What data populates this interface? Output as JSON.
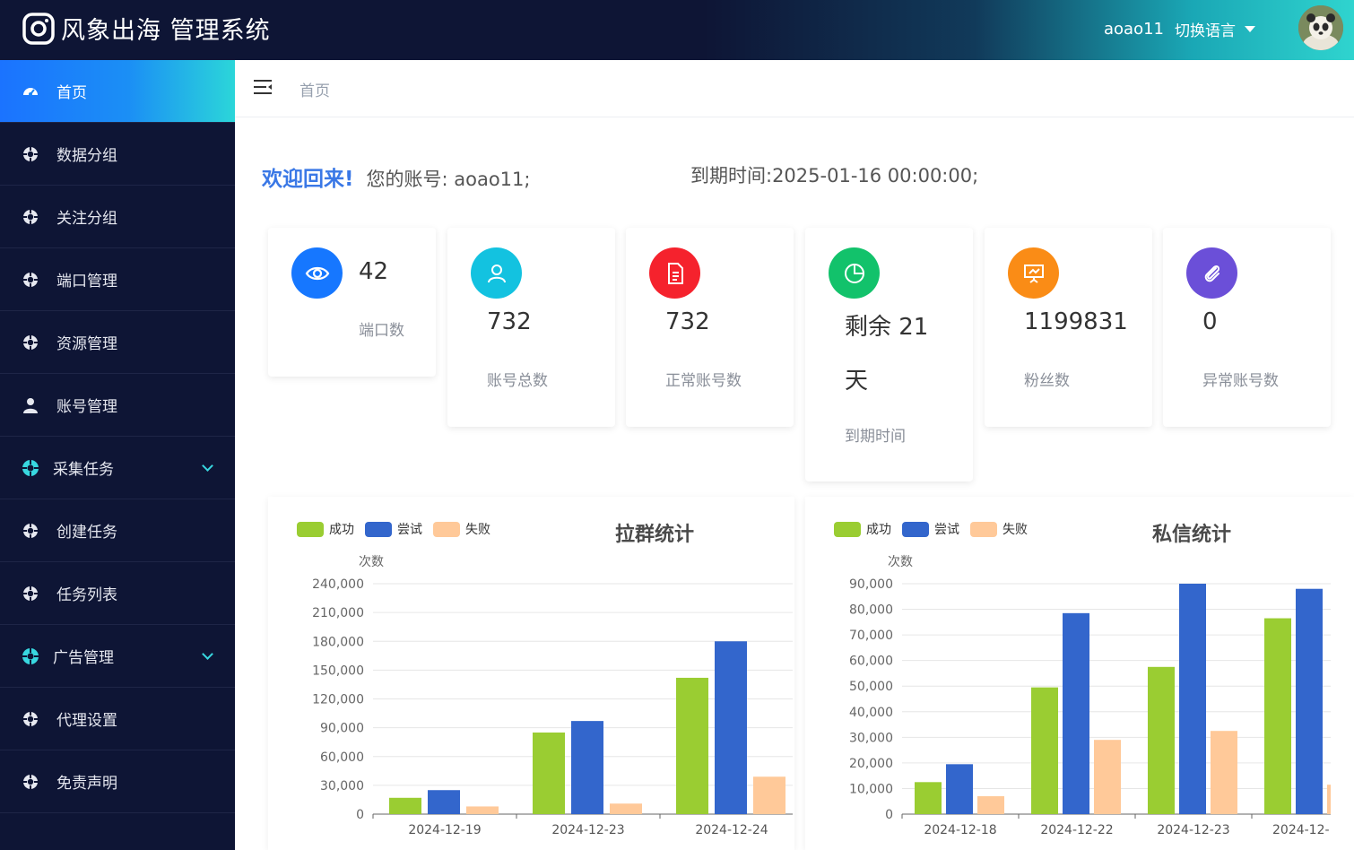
{
  "header": {
    "app_title": "风象出海 管理系统",
    "user_name": "aoao11",
    "lang_switch_label": "切换语言"
  },
  "sidebar": {
    "items": [
      {
        "label": "首页",
        "icon": "dashboard-icon",
        "active": true
      },
      {
        "label": "数据分组",
        "icon": "crosshair-icon"
      },
      {
        "label": "关注分组",
        "icon": "crosshair-icon"
      },
      {
        "label": "端口管理",
        "icon": "crosshair-icon"
      },
      {
        "label": "资源管理",
        "icon": "crosshair-icon"
      },
      {
        "label": "账号管理",
        "icon": "user-icon"
      },
      {
        "label": "采集任务",
        "icon": "crosshair-icon",
        "group": true
      },
      {
        "label": "创建任务",
        "icon": "crosshair-icon"
      },
      {
        "label": "任务列表",
        "icon": "crosshair-icon"
      },
      {
        "label": "广告管理",
        "icon": "crosshair-icon",
        "group": true
      },
      {
        "label": "代理设置",
        "icon": "crosshair-icon"
      },
      {
        "label": "免责声明",
        "icon": "crosshair-icon"
      }
    ]
  },
  "breadcrumb": "首页",
  "welcome": {
    "title": "欢迎回来!",
    "account": "您的账号: aoao11;",
    "expire": "到期时间:2025-01-16 00:00:00;"
  },
  "stats": [
    {
      "value": "42",
      "label": "端口数",
      "icon": "eye-icon",
      "color": "#1677ff"
    },
    {
      "value": "732",
      "label": "账号总数",
      "icon": "user-outline-icon",
      "color": "#13c2e0"
    },
    {
      "value": "732",
      "label": "正常账号数",
      "icon": "document-icon",
      "color": "#f5222d"
    },
    {
      "value_line1": "剩余 21",
      "value_line2": "天",
      "label": "到期时间",
      "icon": "pie-chart-icon",
      "color": "#12c26b"
    },
    {
      "value": "1199831",
      "label": "粉丝数",
      "icon": "presentation-icon",
      "color": "#fa8c16"
    },
    {
      "value": "0",
      "label": "异常账号数",
      "icon": "paperclip-icon",
      "color": "#6b4fd8"
    }
  ],
  "legend": {
    "success": "成功",
    "attempt": "尝试",
    "fail": "失败"
  },
  "colors": {
    "success": "#9acd32",
    "attempt": "#3366cc",
    "fail": "#ffc999"
  },
  "chart_data": [
    {
      "type": "bar",
      "title": "拉群统计",
      "ylabel": "次数",
      "categories": [
        "2024-12-19",
        "2024-12-23",
        "2024-12-24"
      ],
      "ylim": [
        0,
        240000
      ],
      "yticks": [
        0,
        30000,
        60000,
        90000,
        120000,
        150000,
        180000,
        210000,
        240000
      ],
      "series": [
        {
          "name": "成功",
          "values": [
            17000,
            85000,
            142000
          ]
        },
        {
          "name": "尝试",
          "values": [
            25000,
            97000,
            180000
          ]
        },
        {
          "name": "失败",
          "values": [
            8000,
            11000,
            39000
          ]
        }
      ]
    },
    {
      "type": "bar",
      "title": "私信统计",
      "ylabel": "次数",
      "categories": [
        "2024-12-18",
        "2024-12-22",
        "2024-12-23",
        "2024-12-"
      ],
      "ylim": [
        0,
        90000
      ],
      "yticks": [
        0,
        10000,
        20000,
        30000,
        40000,
        50000,
        60000,
        70000,
        80000,
        90000
      ],
      "series": [
        {
          "name": "成功",
          "values": [
            12500,
            49500,
            57500,
            76500
          ]
        },
        {
          "name": "尝试",
          "values": [
            19500,
            78500,
            90000,
            88000
          ]
        },
        {
          "name": "失败",
          "values": [
            7000,
            29000,
            32500,
            11500
          ]
        }
      ]
    }
  ]
}
